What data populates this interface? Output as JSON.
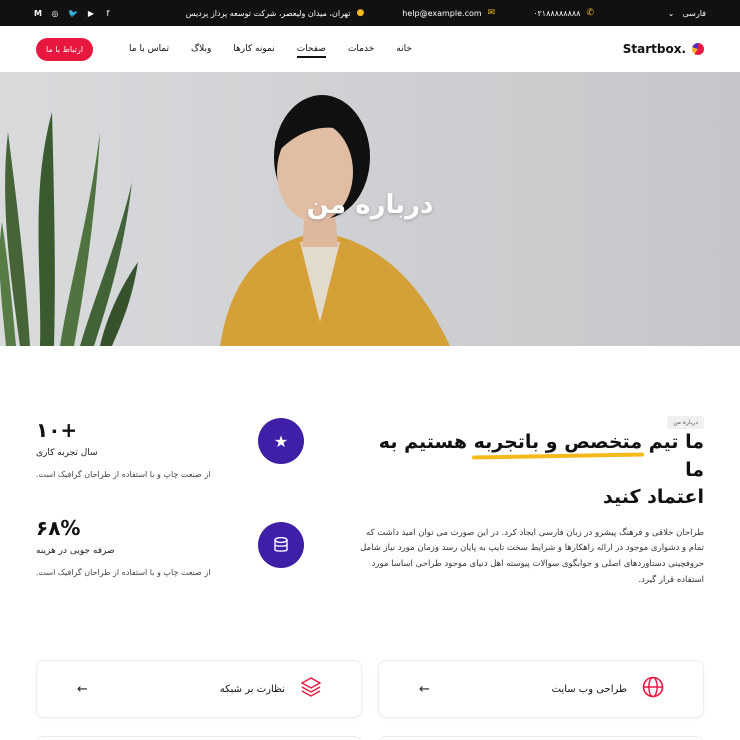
{
  "topbar": {
    "language": "فارسی",
    "phone": "۰۲۱۸۸۸۸۸۸۸۸",
    "email": "help@example.com",
    "address": "تهران، میدان ولیعصر، شرکت توسعه پرداز پردیس",
    "social_icons": [
      "facebook-icon",
      "youtube-icon",
      "twitter-icon",
      "instagram-icon",
      "medium-icon"
    ]
  },
  "navbar": {
    "brand": "Startbox.",
    "menu": [
      {
        "label": "خانه"
      },
      {
        "label": "خدمات"
      },
      {
        "label": "صفحات",
        "active": true
      },
      {
        "label": "نمونه کارها"
      },
      {
        "label": "وبلاگ"
      },
      {
        "label": "تماس با ما"
      }
    ],
    "cta": "ارتباط با ما"
  },
  "hero": {
    "title": "درباره من"
  },
  "about": {
    "badge": "درباره من",
    "heading_line1_pre": "ما تیم ",
    "heading_highlight": "متخصص و باتجربه",
    "heading_line1_post": " هستیم به ما",
    "heading_line2": "اعتماد کنید",
    "paragraph": "طراحان خلاقی و فرهنگ پیشرو در زبان فارسی ایجاد کرد. در این صورت می توان امید داشت که تمام و دشواری موجود در ارائه راهکارها و شرایط سخت تایپ به پایان رسد وزمان مورد نیاز شامل حروفچینی دستاوردهای اصلی و جوابگوی سوالات پیوسته اهل دنیای موجود طراحی اساسا مورد استفاده قرار گیرد.",
    "stats": [
      {
        "number": "+۱۰",
        "label": "سال تجربه کاری",
        "description": "از صنعت چاپ و با استفاده از طراحان گرافیک است.",
        "icon": "star-icon"
      },
      {
        "number": "۶۸%",
        "label": "صرفه جویی در هزینه",
        "description": "از صنعت چاپ و با استفاده از طراحان گرافیک است.",
        "icon": "database-icon"
      }
    ]
  },
  "services": [
    {
      "title": "طراحی وب سایت",
      "icon": "globe-icon"
    },
    {
      "title": "نظارت بر شبکه",
      "icon": "layers-icon"
    }
  ],
  "colors": {
    "accent": "#e8173f",
    "purple": "#3f1fa8",
    "highlight": "#f5b91b",
    "topbar": "#111111"
  }
}
